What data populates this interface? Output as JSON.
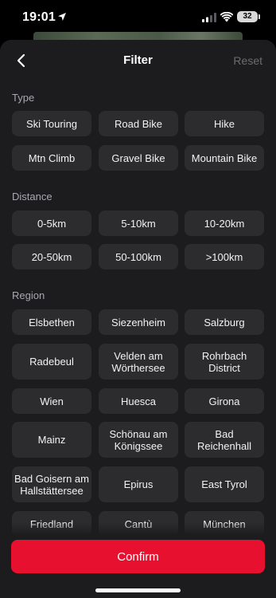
{
  "status": {
    "time": "19:01",
    "battery": "32"
  },
  "header": {
    "title": "Filter",
    "reset_label": "Reset"
  },
  "sections": {
    "type": {
      "label": "Type",
      "options": [
        "Ski Touring",
        "Road Bike",
        "Hike",
        "Mtn Climb",
        "Gravel Bike",
        "Mountain Bike"
      ]
    },
    "distance": {
      "label": "Distance",
      "options": [
        "0-5km",
        "5-10km",
        "10-20km",
        "20-50km",
        "50-100km",
        ">100km"
      ]
    },
    "region": {
      "label": "Region",
      "options": [
        "Elsbethen",
        "Siezenheim",
        "Salzburg",
        "Radebeul",
        "Velden am Wörthersee",
        "Rohrbach District",
        "Wien",
        "Huesca",
        "Girona",
        "Mainz",
        "Schönau am Königssee",
        "Bad Reichenhall",
        "Bad Goisern am Hallstättersee",
        "Epirus",
        "East Tyrol",
        "Friedland",
        "Cantù",
        "München"
      ]
    }
  },
  "footer": {
    "confirm_label": "Confirm"
  },
  "colors": {
    "accent": "#e8102f",
    "chip_bg": "#2c2c2e",
    "sheet_bg": "#1c1c1e"
  }
}
